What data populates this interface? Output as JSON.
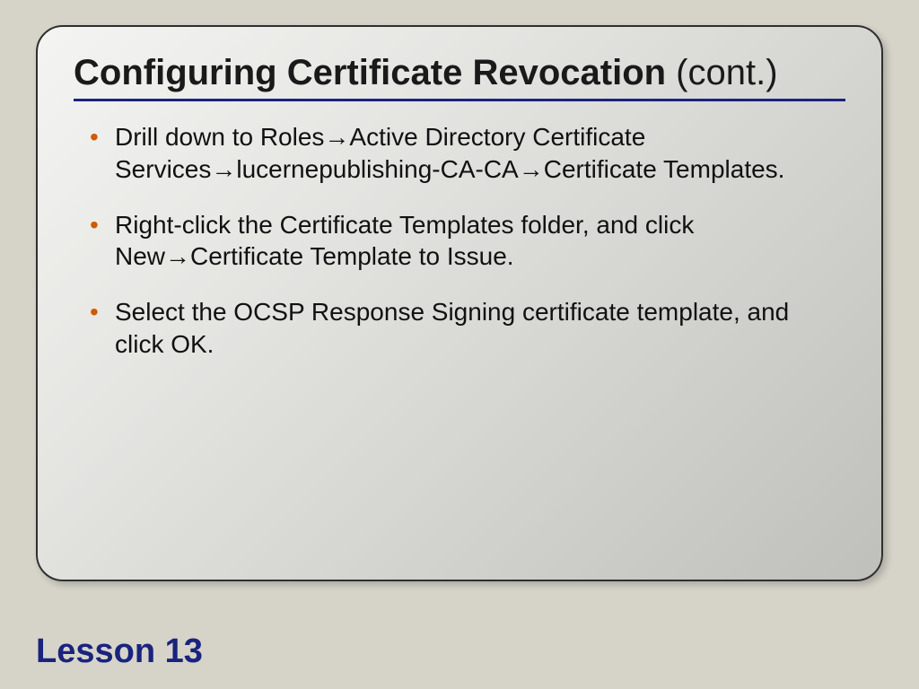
{
  "title": {
    "main": "Configuring Certificate Revocation",
    "suffix": " (cont.)"
  },
  "bullets": [
    "Drill down to Roles→Active Directory Certificate Services→lucernepublishing-CA-CA→Certificate Templates.",
    "Right-click the Certificate Templates folder, and click New→Certificate Template to Issue.",
    "Select the OCSP Response Signing certificate template, and click OK."
  ],
  "footer": "Lesson 13"
}
